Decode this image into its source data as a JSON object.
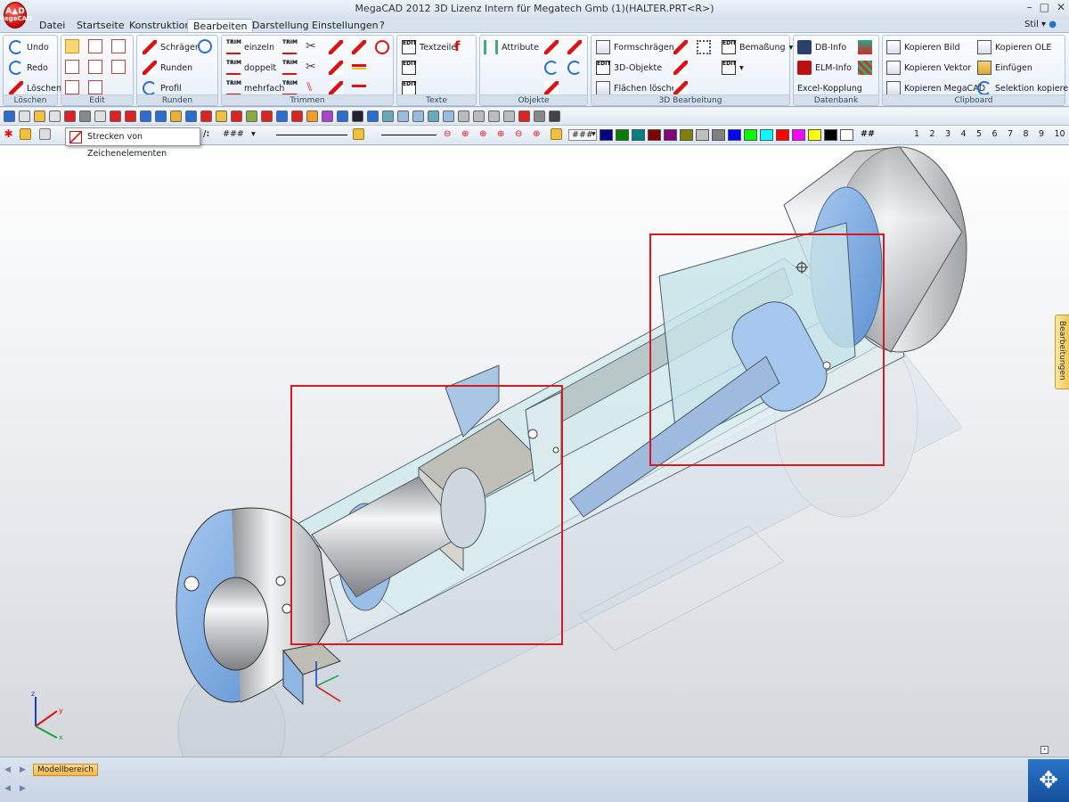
{
  "window": {
    "title": "MegaCAD 2012 3D  Lizenz Intern für Megatech Gmb (1)(HALTER.PRT<R>)",
    "logo_text": "MegaCAD"
  },
  "tabs": [
    {
      "label": "Datei"
    },
    {
      "label": "Startseite"
    },
    {
      "label": "Konstruktion"
    },
    {
      "label": "Bearbeiten"
    },
    {
      "label": "Darstellung"
    },
    {
      "label": "Einstellungen"
    },
    {
      "label": "?"
    }
  ],
  "style_menu": "Stil",
  "ribbon": {
    "loeschen": {
      "label": "Löschen",
      "undo": "Undo",
      "redo": "Redo",
      "delete": "Löschen"
    },
    "edit": {
      "label": "Edit"
    },
    "runden": {
      "label": "Runden",
      "schraegen": "Schrägen",
      "runden_btn": "Runden",
      "profil": "Profil"
    },
    "trimmen": {
      "label": "Trimmen",
      "einzeln": "einzeln",
      "doppelt": "doppelt",
      "mehrfach": "mehrfach"
    },
    "texte": {
      "label": "Texte",
      "textzeile": "Textzeile"
    },
    "objekte": {
      "label": "Objekte",
      "attribute": "Attribute"
    },
    "bearbeitung3d": {
      "label": "3D Bearbeitung",
      "formschraegen": "Formschrägen",
      "objekte3d": "3D-Objekte",
      "flaechen": "Flächen löschen",
      "bemassung": "Bemaßung"
    },
    "datenbank": {
      "label": "Datenbank",
      "dbinfo": "DB-Info",
      "elminfo": "ELM-Info",
      "excel": "Excel-Kopplung"
    },
    "clipboard": {
      "label": "Clipboard",
      "bild": "Kopieren Bild",
      "vektor": "Kopieren Vektor",
      "megacad": "Kopieren MegaCAD",
      "ole": "Kopieren OLE",
      "einfuegen": "Einfügen",
      "selektion": "Selektion kopieren"
    }
  },
  "toolbar2": {
    "pattern1": "###",
    "pattern2": "###",
    "numbers": [
      "1",
      "2",
      "3",
      "4",
      "5",
      "6",
      "7",
      "8",
      "9",
      "10"
    ],
    "colors": [
      "#000080",
      "#008000",
      "#008080",
      "#800000",
      "#800080",
      "#808000",
      "#c0c0c0",
      "#808080",
      "#0000ff",
      "#00ff00",
      "#00ffff",
      "#ff0000",
      "#ff00ff",
      "#ffff00",
      "#000000",
      "#ffffff"
    ]
  },
  "tooltip": "Strecken von Zeichenelementen",
  "side_panel": "Bearbeitungen",
  "status": {
    "model_tab": "Modellbereich"
  },
  "axes": {
    "x": "x",
    "y": "y",
    "z": "z"
  }
}
